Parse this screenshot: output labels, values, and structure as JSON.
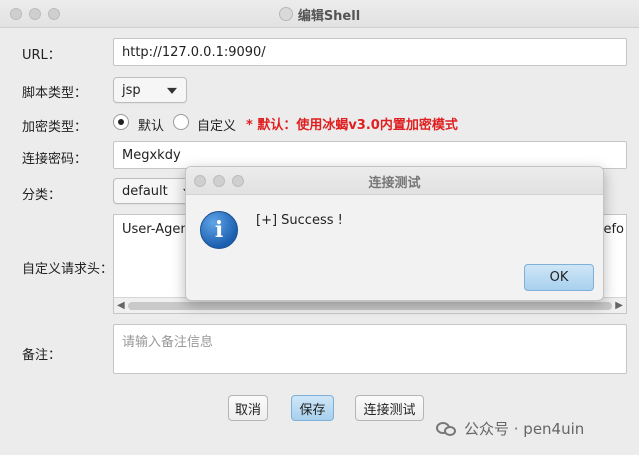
{
  "window": {
    "title": "编辑Shell"
  },
  "form": {
    "url_label": "URL：",
    "url_value": "http://127.0.0.1:9090/",
    "script_type_label": "脚本类型：",
    "script_type_value": "jsp",
    "encrypt_label": "加密类型：",
    "encrypt_default": "默认",
    "encrypt_custom": "自定义",
    "encrypt_note": "* 默认：使用冰蝎v3.0内置加密模式",
    "password_label": "连接密码：",
    "password_value": "Megxkdy",
    "category_label": "分类：",
    "category_value": "default",
    "headers_label": "自定义请求头：",
    "headers_value_left": "User-Agent",
    "headers_value_right": "Firefo",
    "remark_label": "备注：",
    "remark_placeholder": "请输入备注信息"
  },
  "buttons": {
    "cancel": "取消",
    "save": "保存",
    "test": "连接测试"
  },
  "dialog": {
    "title": "连接测试",
    "message": "[+] Success !",
    "ok": "OK"
  },
  "watermark": {
    "text": "公众号 · pen4uin"
  },
  "colors": {
    "warning": "#e02020",
    "primary_button": "#a8d0ee",
    "info_icon": "#1c5fb0"
  }
}
